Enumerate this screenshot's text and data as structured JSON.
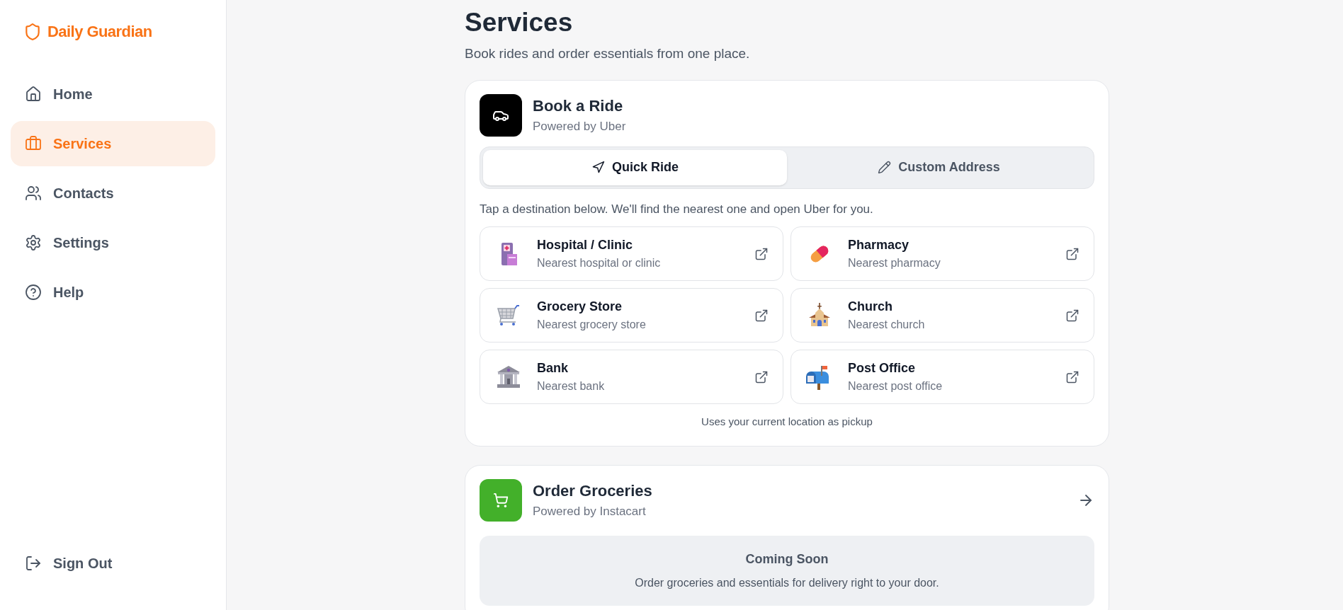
{
  "brand": {
    "name": "Daily Guardian"
  },
  "sidebar": {
    "items": [
      {
        "kind": "home",
        "label": "Home",
        "selected": false
      },
      {
        "kind": "services",
        "label": "Services",
        "selected": true
      },
      {
        "kind": "contacts",
        "label": "Contacts",
        "selected": false
      },
      {
        "kind": "settings",
        "label": "Settings",
        "selected": false
      },
      {
        "kind": "help",
        "label": "Help",
        "selected": false
      }
    ],
    "sign_out": "Sign Out"
  },
  "page": {
    "title": "Services",
    "subtitle": "Book rides and order essentials from one place."
  },
  "ride_card": {
    "title": "Book a Ride",
    "subtitle": "Powered by Uber",
    "tabs": [
      {
        "kind": "quick",
        "label": "Quick Ride",
        "selected": true
      },
      {
        "kind": "custom",
        "label": "Custom Address",
        "selected": false
      }
    ],
    "hint": "Tap a destination below. We'll find the nearest one and open Uber for you.",
    "destinations": [
      {
        "kind": "hospital",
        "title": "Hospital / Clinic",
        "subtitle": "Nearest hospital or clinic"
      },
      {
        "kind": "pharmacy",
        "title": "Pharmacy",
        "subtitle": "Nearest pharmacy"
      },
      {
        "kind": "grocery",
        "title": "Grocery Store",
        "subtitle": "Nearest grocery store"
      },
      {
        "kind": "church",
        "title": "Church",
        "subtitle": "Nearest church"
      },
      {
        "kind": "bank",
        "title": "Bank",
        "subtitle": "Nearest bank"
      },
      {
        "kind": "post",
        "title": "Post Office",
        "subtitle": "Nearest post office"
      }
    ],
    "footnote": "Uses your current location as pickup"
  },
  "grocery_card": {
    "title": "Order Groceries",
    "subtitle": "Powered by Instacart",
    "notice_title": "Coming Soon",
    "notice_text": "Order groceries and essentials for delivery right to your door."
  }
}
